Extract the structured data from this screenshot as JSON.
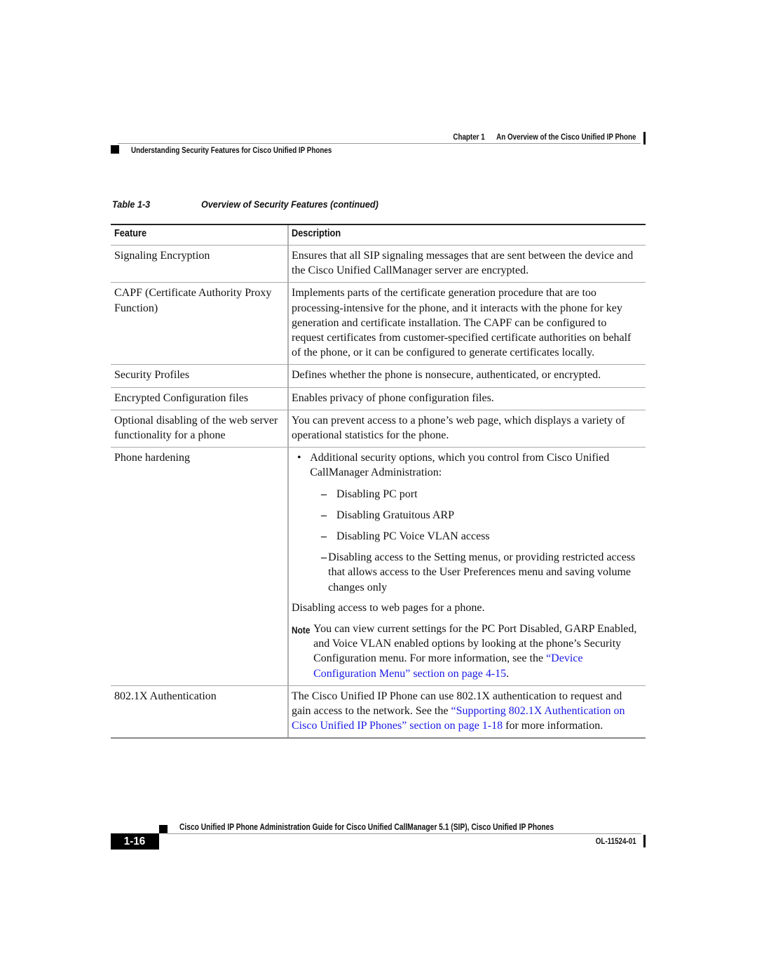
{
  "header": {
    "chapter_label": "Chapter 1",
    "chapter_title": "An Overview of the Cisco Unified IP Phone",
    "section_title": "Understanding Security Features for Cisco Unified IP Phones"
  },
  "table": {
    "caption_number": "Table 1-3",
    "caption_title": "Overview of Security Features (continued)",
    "columns": [
      "Feature",
      "Description"
    ],
    "rows": [
      {
        "feature": "Signaling Encryption",
        "description": "Ensures that all SIP signaling messages that are sent between the device and the Cisco Unified CallManager server are encrypted."
      },
      {
        "feature": "CAPF (Certificate Authority Proxy Function)",
        "description": "Implements parts of the certificate generation procedure that are too processing-intensive for the phone, and it interacts with the phone for key generation and certificate installation. The CAPF can be configured to request certificates from customer-specified certificate authorities on behalf of the phone, or it can be configured to generate certificates locally."
      },
      {
        "feature": "Security Profiles",
        "description": "Defines whether the phone is nonsecure, authenticated, or encrypted."
      },
      {
        "feature": "Encrypted Configuration files",
        "description": "Enables privacy of phone configuration files."
      },
      {
        "feature": "Optional disabling of the web server functionality for a phone",
        "description": "You can prevent access to a phone’s web page, which displays a variety of operational statistics for the phone."
      },
      {
        "feature": "Phone hardening",
        "bullet_mark": "•",
        "bullet": "Additional security options, which you control from Cisco Unified CallManager Administration:",
        "sub_mark": "–",
        "sub_items": [
          "Disabling PC port",
          "Disabling Gratuitous ARP",
          "Disabling PC Voice VLAN access",
          "Disabling access to the Setting menus, or providing restricted access that allows access to the User Preferences menu and saving volume changes only"
        ],
        "paragraph": "Disabling access to web pages for a phone.",
        "note_label": "Note",
        "note_text": "You can view current settings for the PC Port Disabled, GARP Enabled, and Voice VLAN enabled options by looking at the phone’s Security Configuration menu. For more information, see the ",
        "note_link": "“Device Configuration Menu” section on page 4-15",
        "note_end": "."
      },
      {
        "feature": "802.1X Authentication",
        "desc_before": "The Cisco Unified IP Phone can use 802.1X authentication to request and gain access to the network. See the ",
        "desc_link": "“Supporting 802.1X Authentication on Cisco Unified IP Phones” section on page 1-18",
        "desc_after": " for more information."
      }
    ]
  },
  "footer": {
    "guide_title": "Cisco Unified IP Phone Administration Guide for Cisco Unified CallManager 5.1 (SIP), Cisco Unified IP Phones",
    "page_number": "1-16",
    "doc_number": "OL-11524-01"
  },
  "colors": {
    "link": "#1a1ae6",
    "rule": "#9a9a9a",
    "text": "#111111"
  }
}
